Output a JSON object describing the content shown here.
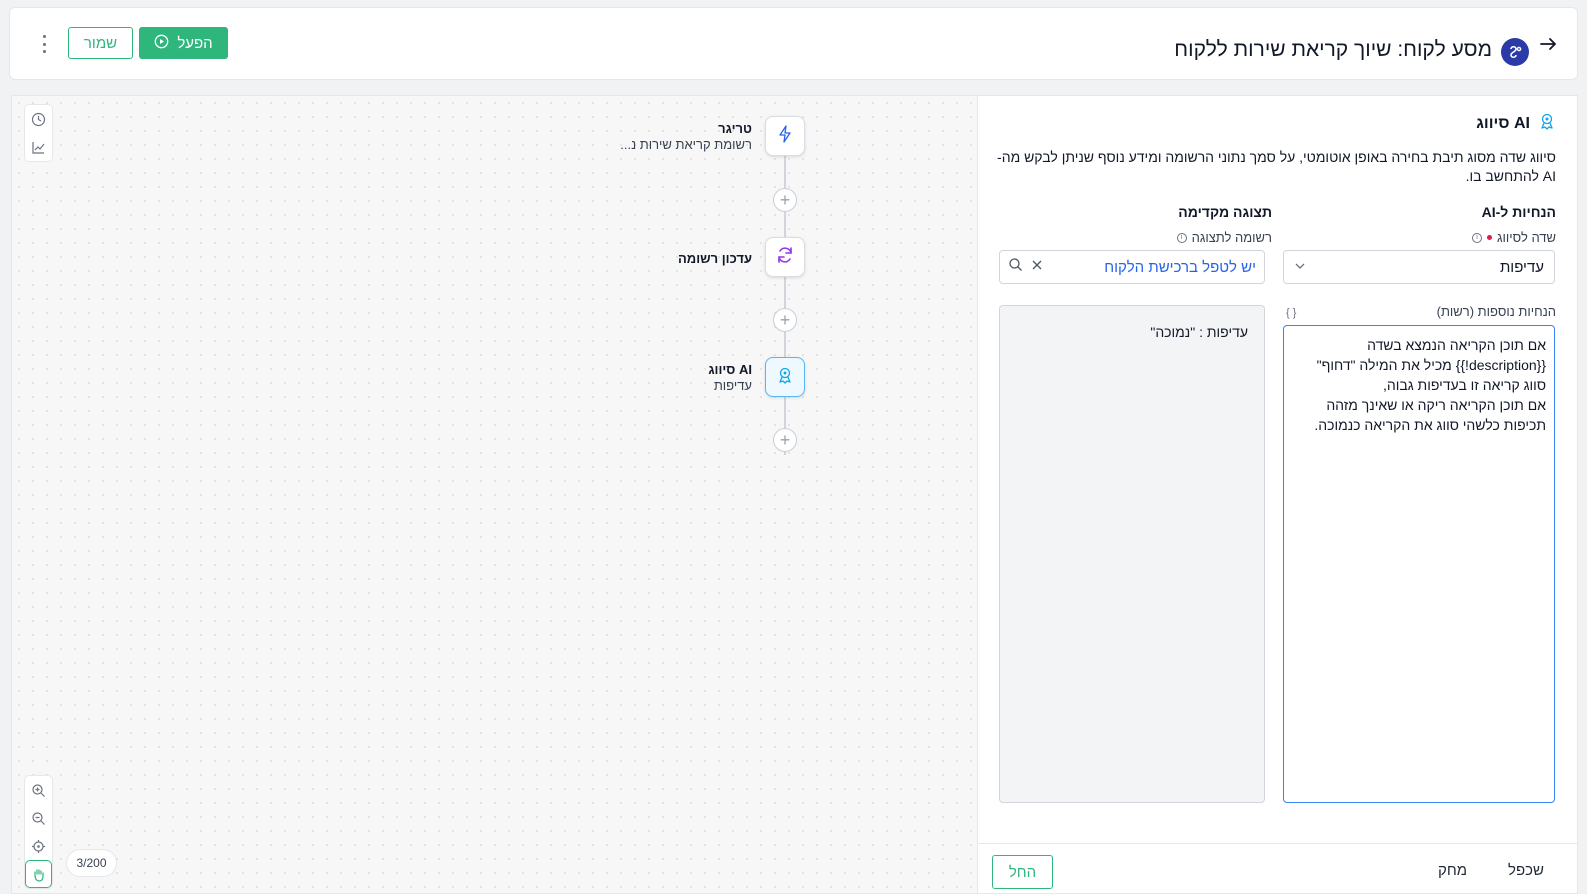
{
  "header": {
    "title": "מסע לקוח: שיוך קריאת שירות ללקוח",
    "run_label": "הפעל",
    "save_label": "שמור",
    "colors": {
      "accent": "#2eb67d",
      "logo": "#2b3aa6"
    }
  },
  "flow": {
    "nodes": [
      {
        "title": "טריגר",
        "subtitle": "רשומת קריאת שירות נ...",
        "icon": "lightning-icon"
      },
      {
        "title": "עדכון רשומה",
        "subtitle": "",
        "icon": "refresh-icon"
      },
      {
        "title": "AI סיווג",
        "subtitle": "עדיפות",
        "icon": "ai-classify-icon"
      }
    ],
    "zoom_counter": "3/200"
  },
  "panel": {
    "title": "AI סיווג",
    "description": "סיווג שדה מסוג תיבת בחירה באופן אוטומטי, על סמך נתוני הרשומה ומידע נוסף שניתן לבקש מה-AI להתחשב בו.",
    "ai_instructions_heading": "הנחיות ל-AI",
    "preview_heading": "תצוגה מקדימה",
    "field_label": "שדה לסיווג",
    "field_value": "עדיפות",
    "record_label": "רשומה לתצוגה",
    "record_value": "יש לטפל ברכישת הלקוח",
    "extra_label": "הנחיות נוספות (רשות)",
    "extra_lines": [
      "אם תוכן הקריאה הנמצא בשדה",
      "{{description!}} מכיל את המילה \"דחוף\"",
      "סווג קריאה זו בעדיפות גבוה,",
      "אם תוכן הקריאה ריקה או שאינך מזהה",
      "תכיפות כלשהי סווג את הקריאה כנמוכה."
    ],
    "preview_result": "עדיפות : \"נמוכה\"",
    "apply_label": "החל",
    "delete_label": "מחק",
    "duplicate_label": "שכפל"
  }
}
